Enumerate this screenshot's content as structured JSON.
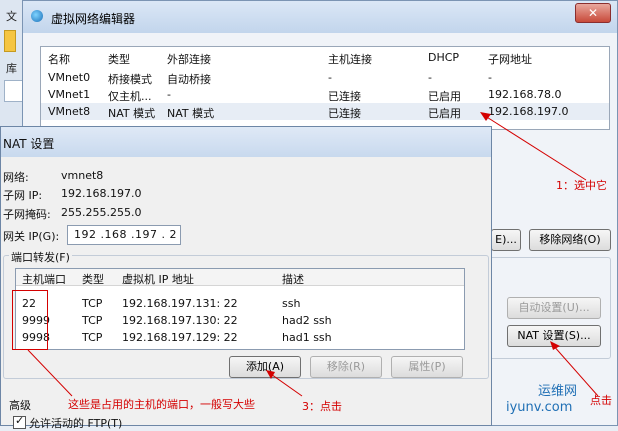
{
  "background": {
    "menu_label": "文",
    "side_label": "库"
  },
  "vmnet_editor": {
    "title": "虚拟网络编辑器",
    "close": "✕",
    "columns": [
      "名称",
      "类型",
      "外部连接",
      "主机连接",
      "DHCP",
      "子网地址"
    ],
    "rows": [
      [
        "VMnet0",
        "桥接模式",
        "自动桥接",
        "-",
        "-",
        "-"
      ],
      [
        "VMnet1",
        "仅主机...",
        "-",
        "已连接",
        "已启用",
        "192.168.78.0"
      ],
      [
        "VMnet8",
        "NAT 模式",
        "NAT 模式",
        "已连接",
        "已启用",
        "192.168.197.0"
      ]
    ],
    "selected_row": 2,
    "btn_partial": "E)...",
    "btn_remove": "移除网络(O)",
    "btn_auto": "自动设置(U)...",
    "btn_nat": "NAT 设置(S)..."
  },
  "nat_dialog": {
    "title": "NAT 设置",
    "network_label": "网络:",
    "network_value": "vmnet8",
    "subnet_ip_label": "子网 IP:",
    "subnet_ip_value": "192.168.197.0",
    "mask_label": "子网掩码:",
    "mask_value": "255.255.255.0",
    "gateway_label": "网关 IP(G):",
    "gateway_value": "192 .168 .197 . 2",
    "port_forward_label": "端口转发(F)",
    "pf_columns": [
      "主机端口",
      "类型",
      "虚拟机 IP 地址",
      "描述"
    ],
    "pf_rows": [
      [
        "22",
        "TCP",
        "192.168.197.131: 22",
        "ssh"
      ],
      [
        "9999",
        "TCP",
        "192.168.197.130: 22",
        "had2 ssh"
      ],
      [
        "9998",
        "TCP",
        "192.168.197.129: 22",
        "had1 ssh"
      ]
    ],
    "btn_add": "添加(A)",
    "btn_remove": "移除(R)",
    "btn_props": "属性(P)",
    "advanced_label": "高级",
    "ftp_label": "允许活动的 FTP(T)"
  },
  "annotations": {
    "a1": "1：选中它",
    "a_click": "点击",
    "a3": "3：点击",
    "a_ports": "这些是占用的主机的端口，一般写大些"
  },
  "watermark": {
    "text1": "运维网",
    "text2": "iyunv.com"
  },
  "colors": {
    "annotation": "#d40000",
    "title_bar": "#c8d9ee"
  }
}
